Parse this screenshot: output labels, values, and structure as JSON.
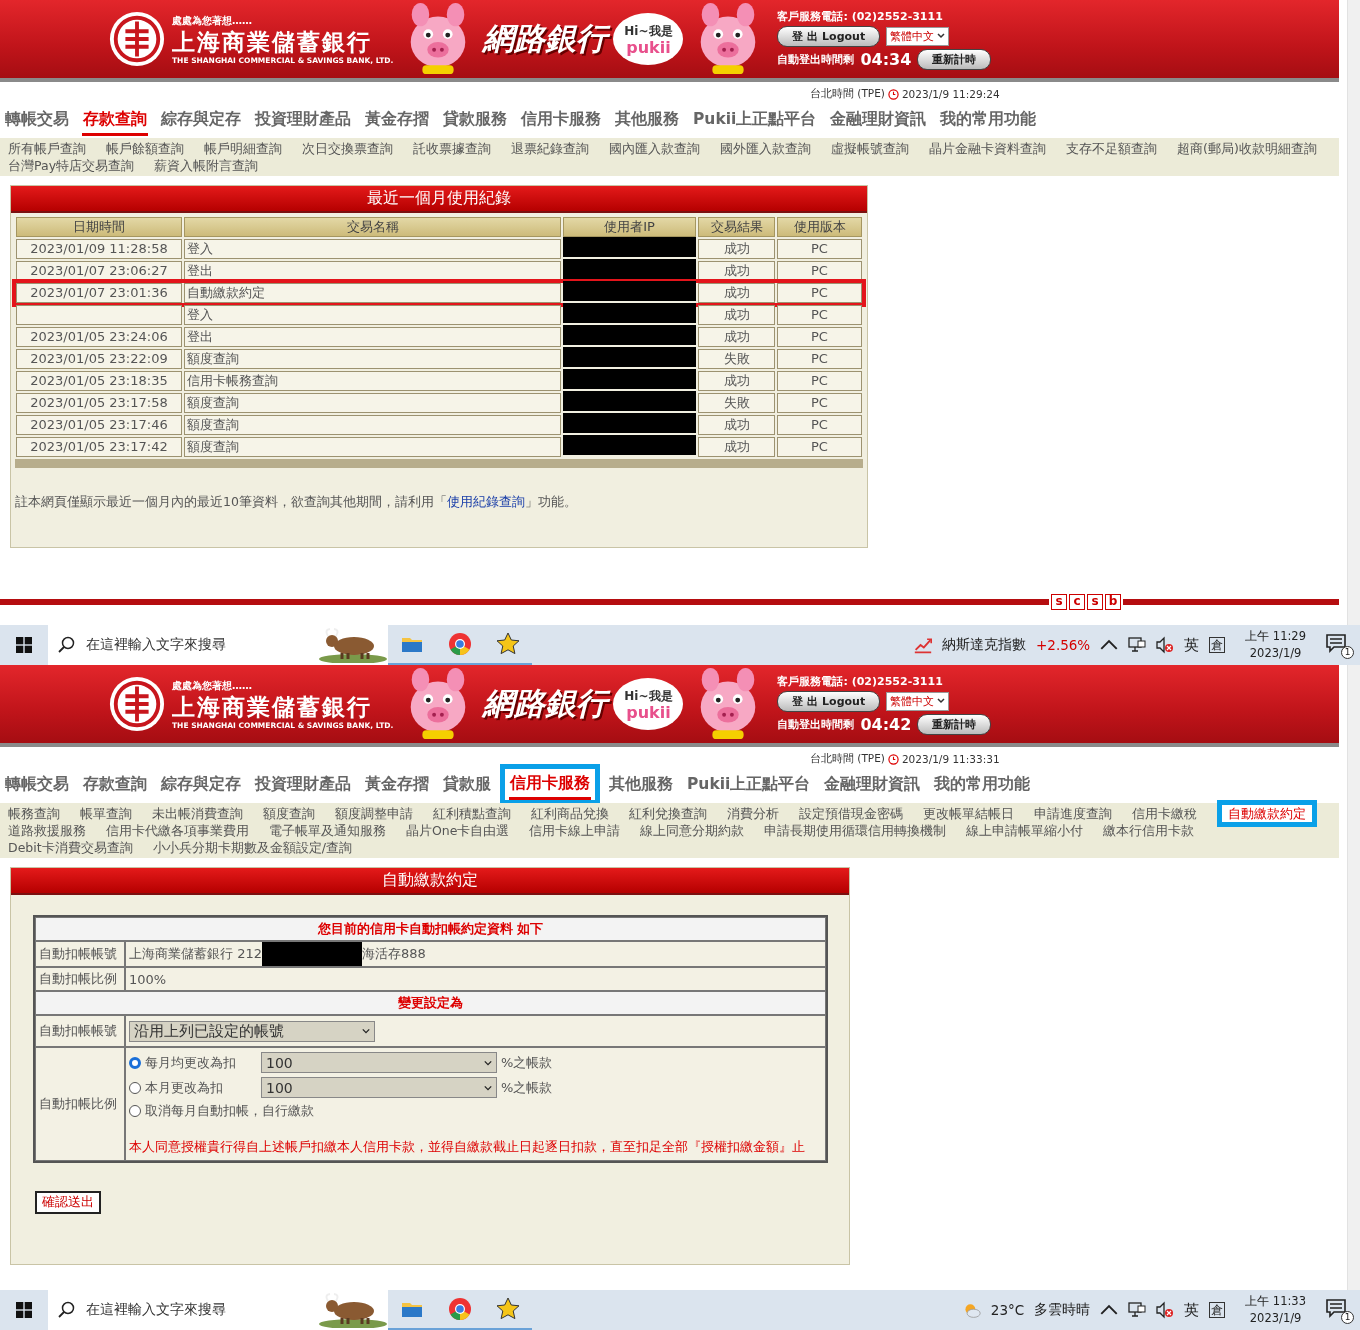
{
  "screens": [
    {
      "header": {
        "tagline": "處處為您著想……",
        "bank_name": "上海商業儲蓄銀行",
        "bank_name_en": "THE SHANGHAI COMMERCIAL & SAVINGS BANK, LTD.",
        "service_name": "網路銀行",
        "bubble_greeting": "Hi~我是",
        "bubble_name": "pukii",
        "phone": "客戶服務電話: (02)2552-3111",
        "logout_button": "登 出  Logout",
        "language": "繁體中文",
        "timer_label": "自動登出時間剩",
        "timer": "04:34",
        "reset_button": "重新計時"
      },
      "clock": {
        "label": "台北時間 (TPE)",
        "time": "2023/1/9 11:29:24"
      },
      "nav": [
        {
          "label": "轉帳交易",
          "selected": false,
          "highlighted": false
        },
        {
          "label": "存款查詢",
          "selected": true,
          "highlighted": false
        },
        {
          "label": "綜存與定存",
          "selected": false,
          "highlighted": false
        },
        {
          "label": "投資理財產品",
          "selected": false,
          "highlighted": false
        },
        {
          "label": "黃金存摺",
          "selected": false,
          "highlighted": false
        },
        {
          "label": "貸款服務",
          "selected": false,
          "highlighted": false
        },
        {
          "label": "信用卡服務",
          "selected": false,
          "highlighted": false
        },
        {
          "label": "其他服務",
          "selected": false,
          "highlighted": false
        },
        {
          "label": "Pukii上正點平台",
          "selected": false,
          "highlighted": false
        },
        {
          "label": "金融理財資訊",
          "selected": false,
          "highlighted": false
        },
        {
          "label": "我的常用功能",
          "selected": false,
          "highlighted": false
        }
      ],
      "subnav": [
        {
          "label": "所有帳戶查詢",
          "highlighted": false
        },
        {
          "label": "帳戶餘額查詢",
          "highlighted": false
        },
        {
          "label": "帳戶明細查詢",
          "highlighted": false
        },
        {
          "label": "次日交換票查詢",
          "highlighted": false
        },
        {
          "label": "託收票據查詢",
          "highlighted": false
        },
        {
          "label": "退票紀錄查詢",
          "highlighted": false
        },
        {
          "label": "國內匯入款查詢",
          "highlighted": false
        },
        {
          "label": "國外匯入款查詢",
          "highlighted": false
        },
        {
          "label": "虛擬帳號查詢",
          "highlighted": false
        },
        {
          "label": "晶片金融卡資料查詢",
          "highlighted": false
        },
        {
          "label": "支存不足額查詢",
          "highlighted": false
        },
        {
          "label": "超商(郵局)收款明細查詢",
          "highlighted": false
        },
        {
          "label": "台灣Pay特店交易查詢",
          "highlighted": false
        },
        {
          "label": "薪資入帳附言查詢",
          "highlighted": false
        }
      ],
      "content": {
        "kind": "history",
        "title": "最近一個月使用紀錄",
        "columns": [
          "日期時間",
          "交易名稱",
          "使用者IP",
          "交易結果",
          "使用版本"
        ],
        "rows": [
          {
            "date": "2023/01/09 11:28:58",
            "name": "登入",
            "redacted": true,
            "result": "成功",
            "version": "PC",
            "highlighted": false
          },
          {
            "date": "2023/01/07 23:06:27",
            "name": "登出",
            "redacted": true,
            "result": "成功",
            "version": "PC",
            "highlighted": false
          },
          {
            "date": "2023/01/07 23:01:36",
            "name": "自動繳款約定",
            "redacted": true,
            "result": "成功",
            "version": "PC",
            "highlighted": true
          },
          {
            "name": "登入",
            "redacted": true,
            "result": "成功",
            "version": "PC",
            "highlighted": false
          },
          {
            "date": "2023/01/05 23:24:06",
            "name": "登出",
            "redacted": true,
            "result": "成功",
            "version": "PC",
            "highlighted": false
          },
          {
            "date": "2023/01/05 23:22:09",
            "name": "額度查詢",
            "redacted": true,
            "result": "失敗",
            "version": "PC",
            "highlighted": false
          },
          {
            "date": "2023/01/05 23:18:35",
            "name": "信用卡帳務查詢",
            "redacted": true,
            "result": "成功",
            "version": "PC",
            "highlighted": false
          },
          {
            "date": "2023/01/05 23:17:58",
            "name": "額度查詢",
            "redacted": true,
            "result": "失敗",
            "version": "PC",
            "highlighted": false
          },
          {
            "date": "2023/01/05 23:17:46",
            "name": "額度查詢",
            "redacted": true,
            "result": "成功",
            "version": "PC",
            "highlighted": false
          },
          {
            "date": "2023/01/05 23:17:42",
            "name": "額度查詢",
            "redacted": true,
            "result": "成功",
            "version": "PC",
            "highlighted": false
          }
        ],
        "note_before": "註本網頁僅顯示最近一個月內的最近10筆資料，欲查詢其他期間，請利用「",
        "note_link": "使用紀錄查詢",
        "note_after": "」功能。"
      },
      "footer": {
        "logo_letters": [
          "s",
          "c",
          "s",
          "b"
        ]
      },
      "taskbar": {
        "search_placeholder": "在這裡輸入文字來搜尋",
        "widget": {
          "kind": "stock",
          "label": "納斯達克指數",
          "value": "+2.56%"
        },
        "ime": "英",
        "ime_mode": "倉",
        "time": "上午 11:29",
        "date": "2023/1/9",
        "notifications": "1"
      }
    },
    {
      "header": {
        "tagline": "處處為您著想……",
        "bank_name": "上海商業儲蓄銀行",
        "bank_name_en": "THE SHANGHAI COMMERCIAL & SAVINGS BANK, LTD.",
        "service_name": "網路銀行",
        "bubble_greeting": "Hi~我是",
        "bubble_name": "pukii",
        "phone": "客戶服務電話: (02)2552-3111",
        "logout_button": "登 出  Logout",
        "language": "繁體中文",
        "timer_label": "自動登出時間剩",
        "timer": "04:42",
        "reset_button": "重新計時"
      },
      "clock": {
        "label": "台北時間 (TPE)",
        "time": "2023/1/9 11:33:31"
      },
      "nav": [
        {
          "label": "轉帳交易",
          "selected": false,
          "highlighted": false
        },
        {
          "label": "存款查詢",
          "selected": false,
          "highlighted": false
        },
        {
          "label": "綜存與定存",
          "selected": false,
          "highlighted": false
        },
        {
          "label": "投資理財產品",
          "selected": false,
          "highlighted": false
        },
        {
          "label": "黃金存摺",
          "selected": false,
          "highlighted": false
        },
        {
          "label": "貸款服",
          "selected": false,
          "highlighted": false
        },
        {
          "label": "信用卡服務",
          "selected": true,
          "highlighted": true
        },
        {
          "label": "其他服務",
          "selected": false,
          "highlighted": false
        },
        {
          "label": "Pukii上正點平台",
          "selected": false,
          "highlighted": false
        },
        {
          "label": "金融理財資訊",
          "selected": false,
          "highlighted": false
        },
        {
          "label": "我的常用功能",
          "selected": false,
          "highlighted": false
        }
      ],
      "subnav": [
        {
          "label": "帳務查詢",
          "highlighted": false
        },
        {
          "label": "帳單查詢",
          "highlighted": false
        },
        {
          "label": "未出帳消費查詢",
          "highlighted": false
        },
        {
          "label": "額度查詢",
          "highlighted": false
        },
        {
          "label": "額度調整申請",
          "highlighted": false
        },
        {
          "label": "紅利積點查詢",
          "highlighted": false
        },
        {
          "label": "紅利商品兌換",
          "highlighted": false
        },
        {
          "label": "紅利兌換查詢",
          "highlighted": false
        },
        {
          "label": "消費分析",
          "highlighted": false
        },
        {
          "label": "設定預借現金密碼",
          "highlighted": false
        },
        {
          "label": "更改帳單結帳日",
          "highlighted": false
        },
        {
          "label": "申請進度查詢",
          "highlighted": false
        },
        {
          "label": "信用卡繳稅",
          "highlighted": false
        },
        {
          "label": "自動繳款約定",
          "highlighted": true
        },
        {
          "label": "道路救援服務",
          "highlighted": false
        },
        {
          "label": "信用卡代繳各項事業費用",
          "highlighted": false
        },
        {
          "label": "電子帳單及通知服務",
          "highlighted": false
        },
        {
          "label": "晶片One卡自由選",
          "highlighted": false
        },
        {
          "label": "信用卡線上申請",
          "highlighted": false
        },
        {
          "label": "線上同意分期約款",
          "highlighted": false
        },
        {
          "label": "申請長期使用循環信用轉換機制",
          "highlighted": false
        },
        {
          "label": "線上申請帳單縮小付",
          "highlighted": false
        },
        {
          "label": "繳本行信用卡款",
          "highlighted": false
        },
        {
          "label": "Debit卡消費交易查詢",
          "highlighted": false
        },
        {
          "label": "小小兵分期卡期數及金額設定/查詢",
          "highlighted": false
        }
      ],
      "content": {
        "kind": "autopay",
        "title": "自動繳款約定",
        "current_heading": "您目前的信用卡自動扣帳約定資料 如下",
        "current_rows": [
          {
            "label": "自動扣帳帳號",
            "value": "上海商業儲蓄銀行 212",
            "redacted": true,
            "value_after": "海活存888"
          },
          {
            "label": "自動扣帳比例",
            "value": "100%",
            "redacted": false
          }
        ],
        "change_heading": "變更設定為",
        "account_label": "自動扣帳帳號",
        "account_select": "沿用上列已設定的帳號",
        "ratio_label": "自動扣帳比例",
        "options": [
          {
            "label": "每月均更改為扣",
            "selected": true,
            "select": "100",
            "suffix": "%之帳款"
          },
          {
            "label": "本月更改為扣",
            "selected": false,
            "select": "100",
            "suffix": "%之帳款"
          },
          {
            "label": "取消每月自動扣帳，自行繳款",
            "selected": false
          }
        ],
        "notice": "本人同意授權貴行得自上述帳戶扣繳本人信用卡款，並得自繳款截止日起逐日扣款，直至扣足全部『授權扣繳金額』止",
        "submit": "確認送出"
      },
      "taskbar": {
        "search_placeholder": "在這裡輸入文字來搜尋",
        "widget": {
          "kind": "weather",
          "label": "23°C",
          "value": "多雲時晴"
        },
        "ime": "英",
        "ime_mode": "倉",
        "time": "上午 11:33",
        "date": "2023/1/9",
        "notifications": "1"
      }
    }
  ]
}
